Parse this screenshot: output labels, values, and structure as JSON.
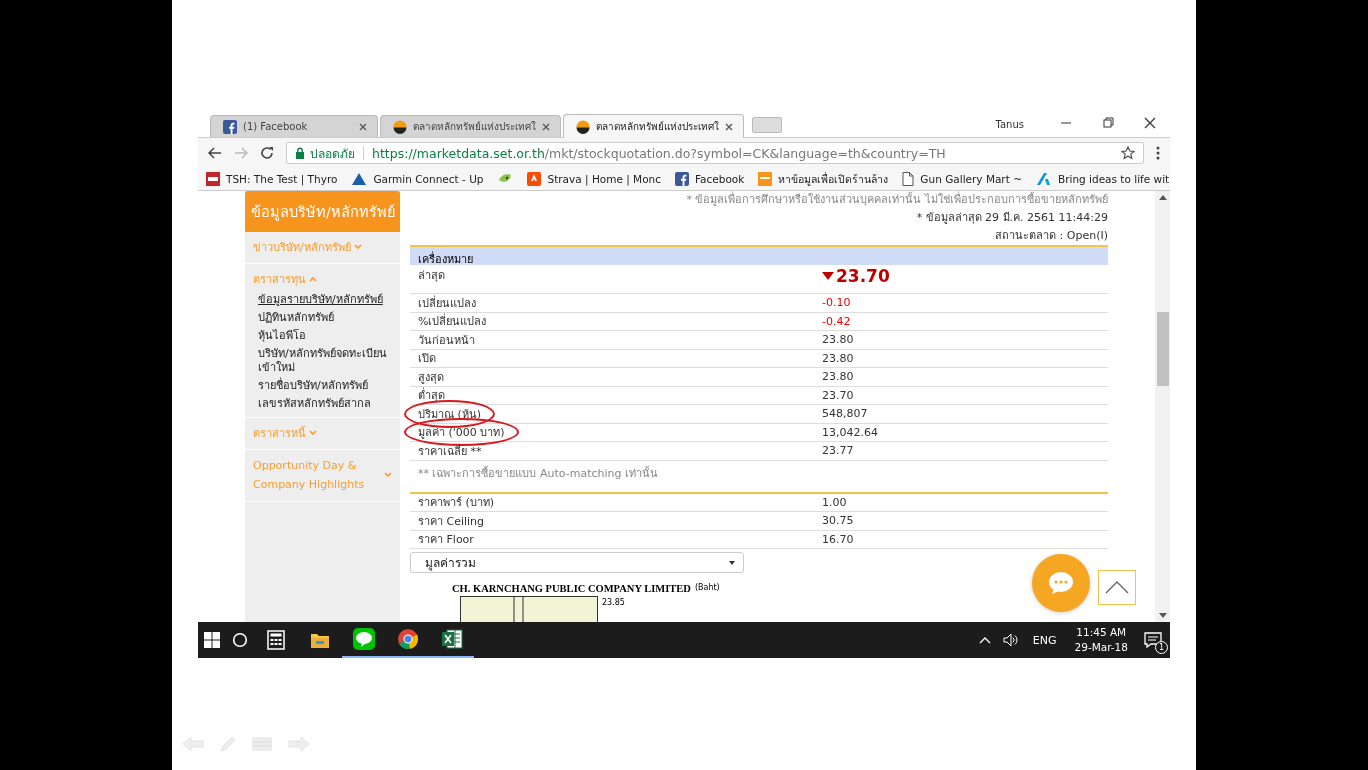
{
  "browser": {
    "tabs": [
      {
        "label": "(1) Facebook",
        "selected": false
      },
      {
        "label": "ตลาดหลักทรัพย์แห่งประเทศใ",
        "selected": false
      },
      {
        "label": "ตลาดหลักทรัพย์แห่งประเทศใ",
        "selected": true
      }
    ],
    "profile": "Tanus",
    "address": {
      "security": "ปลอดภัย",
      "host": "https://marketdata.set.or.th",
      "path": "/mkt/stockquotation.do?symbol=CK&language=th&country=TH"
    },
    "bookmarks": [
      {
        "label": "TSH: The Test | Thyro"
      },
      {
        "label": "Garmin Connect - Up"
      },
      {
        "label": "Strava | Home | Monc"
      },
      {
        "label": "Facebook"
      },
      {
        "label": "หาข้อมูลเพื่อเปิดร้านล้าง"
      },
      {
        "label": "Gun Gallery Mart ~"
      },
      {
        "label": "Bring ideas to life wit"
      }
    ]
  },
  "sidebar": {
    "title": "ข้อมูลบริษัท/หลักทรัพย์",
    "items": [
      {
        "label": "ข่าวบริษัท/หลักทรัพย์",
        "expanded": false
      },
      {
        "label": "ตราสารทุน",
        "expanded": true,
        "children": [
          {
            "label": "ข้อมูลรายบริษัท/หลักทรัพย์",
            "selected": true
          },
          {
            "label": "ปฏิทินหลักทรัพย์",
            "selected": false
          },
          {
            "label": "หุ้นไอพีโอ",
            "selected": false
          },
          {
            "label": "บริษัท/หลักทรัพย์จดทะเบียนเข้าใหม่",
            "selected": false
          },
          {
            "label": "รายชื่อบริษัท/หลักทรัพย์",
            "selected": false
          },
          {
            "label": "เลขรหัสหลักทรัพย์สากล",
            "selected": false
          }
        ]
      },
      {
        "label": "ตราสารหนี้",
        "expanded": false
      },
      {
        "label": "Opportunity Day & Company Highlights",
        "expanded": false
      }
    ]
  },
  "notes": [
    "* ข้อมูลเพื่อการศึกษาหรือใช้งานส่วนบุคคลเท่านั้น ไม่ใช่เพื่อประกอบการซื้อขายหลักทรัพย์",
    "* ข้อมูลล่าสุด 29 มี.ค. 2561 11:44:29",
    "สถานะตลาด : Open(I)"
  ],
  "quote_table": {
    "header": "เครื่องหมาย",
    "rows": [
      {
        "label": "ล่าสุด",
        "value": "23.70",
        "kind": "last"
      },
      {
        "label": "เปลี่ยนแปลง",
        "value": "-0.10",
        "kind": "down"
      },
      {
        "label": "%เปลี่ยนแปลง",
        "value": "-0.42",
        "kind": "down"
      },
      {
        "label": "วันก่อนหน้า",
        "value": "23.80",
        "kind": "plain"
      },
      {
        "label": "เปิด",
        "value": "23.80",
        "kind": "plain"
      },
      {
        "label": "สูงสุด",
        "value": "23.80",
        "kind": "plain"
      },
      {
        "label": "ต่ำสุด",
        "value": "23.70",
        "kind": "plain"
      },
      {
        "label": "ปริมาณ (หุ้น)",
        "value": "548,807",
        "kind": "plain",
        "circled": true
      },
      {
        "label": "มูลค่า ('000 บาท)",
        "value": "13,042.64",
        "kind": "plain",
        "circled": true
      },
      {
        "label": "ราคาเฉลี่ย **",
        "value": "23.77",
        "kind": "plain"
      }
    ],
    "footnote": "** เฉพาะการซื้อขายแบบ Auto-matching เท่านั้น"
  },
  "price_table": {
    "rows": [
      {
        "label": "ราคาพาร์ (บาท)",
        "value": "1.00"
      },
      {
        "label": "ราคา Ceiling",
        "value": "30.75"
      },
      {
        "label": "ราคา Floor",
        "value": "16.70"
      }
    ]
  },
  "chart_select": {
    "value": "มูลค่ารวม"
  },
  "chart": {
    "title": "CH. KARNCHANG PUBLIC COMPANY LIMITED",
    "axis_label": "(Baht)",
    "tick": "23.85"
  },
  "taskbar": {
    "apps": [
      {
        "running": false
      },
      {
        "running": false
      },
      {
        "running": true
      },
      {
        "running": true
      },
      {
        "running": true
      }
    ],
    "language": "ENG",
    "time": "11:45 AM",
    "date": "29-Mar-18",
    "notifications": "1"
  }
}
